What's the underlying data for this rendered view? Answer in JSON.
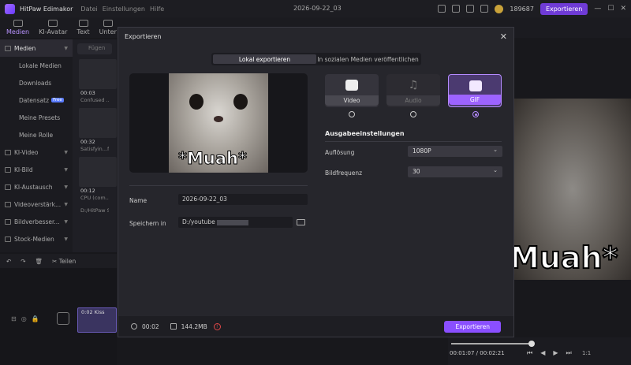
{
  "titlebar": {
    "app_name": "HitPaw Edimakor",
    "menu": [
      "Datei",
      "Einstellungen",
      "Hilfe"
    ],
    "doc_title": "2026-09-22_03",
    "coins": "189687",
    "export_label": "Exportieren"
  },
  "toolbar": {
    "tools": [
      "Medien",
      "KI-Avatar",
      "Text",
      "Unter"
    ]
  },
  "sidebar": {
    "items": [
      {
        "label": "Medien",
        "type": "head"
      },
      {
        "label": "Lokale Medien",
        "type": "sub"
      },
      {
        "label": "Downloads",
        "type": "sub"
      },
      {
        "label": "Datensatz",
        "type": "sub",
        "badge": "Free"
      },
      {
        "label": "Meine Presets",
        "type": "sub"
      },
      {
        "label": "Meine Rolle",
        "type": "sub"
      },
      {
        "label": "KI-Video",
        "type": "group"
      },
      {
        "label": "KI-Bild",
        "type": "group"
      },
      {
        "label": "KI-Austausch",
        "type": "group"
      },
      {
        "label": "Videoverstärk...",
        "type": "group"
      },
      {
        "label": "Bildverbesser...",
        "type": "group"
      },
      {
        "label": "Stock-Medien",
        "type": "group"
      }
    ]
  },
  "media": {
    "search_placeholder": "Fügen",
    "thumbs": [
      {
        "time": "00:03",
        "label": "Confused ...e"
      },
      {
        "time": "00:32",
        "label": "Satisfyin...fem"
      },
      {
        "time": "00:12",
        "label": "CPU (com..."
      }
    ],
    "path": "D:/HitPaw Sc"
  },
  "timeline": {
    "split_label": "Teilen",
    "clip_label": "0:02 Kiss"
  },
  "preview": {
    "overlay_text": "Muah*",
    "time": "00:01:07 / 00:02:21",
    "zoom": "1:1"
  },
  "modal": {
    "title": "Exportieren",
    "tabs": [
      "Lokal exportieren",
      "In sozialen Medien veröffentlichen"
    ],
    "preview_text": "*Muah*",
    "name_label": "Name",
    "name_value": "2026-09-22_03",
    "save_label": "Speichern in",
    "save_value": "D:/youtube",
    "formats": [
      {
        "label": "Video",
        "state": "normal"
      },
      {
        "label": "Audio",
        "state": "dim"
      },
      {
        "label": "GIF",
        "state": "selected"
      }
    ],
    "output_title": "Ausgabeeinstellungen",
    "resolution_label": "Auflösung",
    "resolution_value": "1080P",
    "framerate_label": "Bildfrequenz",
    "framerate_value": "30",
    "duration": "00:02",
    "size": "144.2MB",
    "export_button": "Exportieren"
  },
  "colors": {
    "accent": "#8a4fff",
    "warning": "#e04848"
  }
}
